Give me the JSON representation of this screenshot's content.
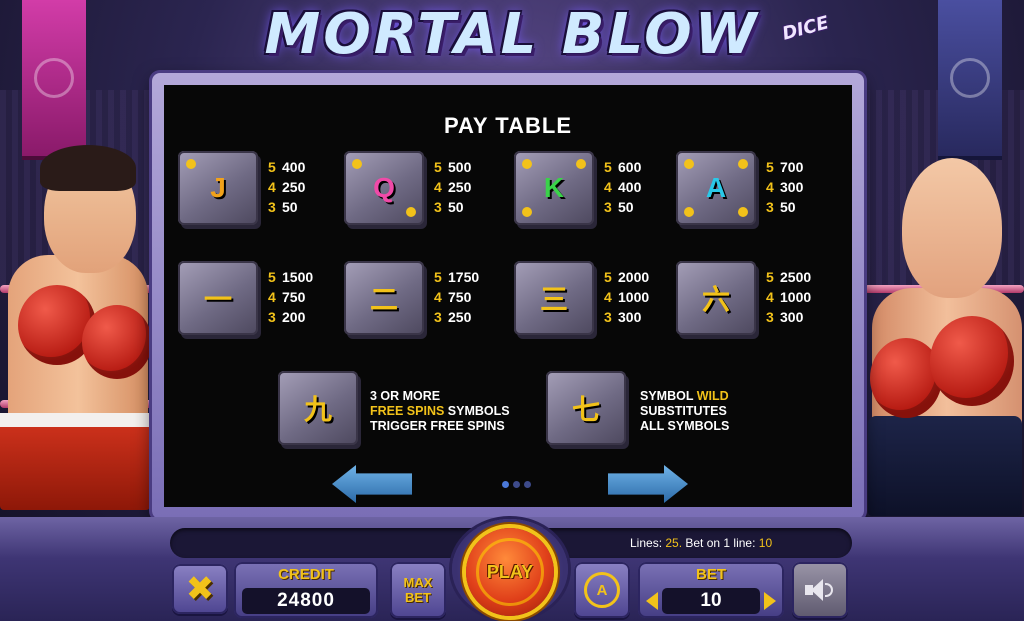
{
  "title": "MORTAL BLOW",
  "title_sub": "DICE",
  "paytable": {
    "heading": "PAY TABLE",
    "symbols": [
      {
        "icon": "J",
        "color": "#f2a21a",
        "pays": [
          {
            "count": "5",
            "value": "400"
          },
          {
            "count": "4",
            "value": "250"
          },
          {
            "count": "3",
            "value": "50"
          }
        ]
      },
      {
        "icon": "Q",
        "color": "#f04aa8",
        "pays": [
          {
            "count": "5",
            "value": "500"
          },
          {
            "count": "4",
            "value": "250"
          },
          {
            "count": "3",
            "value": "50"
          }
        ]
      },
      {
        "icon": "K",
        "color": "#3ad24a",
        "pays": [
          {
            "count": "5",
            "value": "600"
          },
          {
            "count": "4",
            "value": "400"
          },
          {
            "count": "3",
            "value": "50"
          }
        ]
      },
      {
        "icon": "A",
        "color": "#2ac8e8",
        "pays": [
          {
            "count": "5",
            "value": "700"
          },
          {
            "count": "4",
            "value": "300"
          },
          {
            "count": "3",
            "value": "50"
          }
        ]
      },
      {
        "icon": "一",
        "color": "#f2c21a",
        "pays": [
          {
            "count": "5",
            "value": "1500"
          },
          {
            "count": "4",
            "value": "750"
          },
          {
            "count": "3",
            "value": "200"
          }
        ]
      },
      {
        "icon": "二",
        "color": "#f2c21a",
        "pays": [
          {
            "count": "5",
            "value": "1750"
          },
          {
            "count": "4",
            "value": "750"
          },
          {
            "count": "3",
            "value": "250"
          }
        ]
      },
      {
        "icon": "三",
        "color": "#f2c21a",
        "pays": [
          {
            "count": "5",
            "value": "2000"
          },
          {
            "count": "4",
            "value": "1000"
          },
          {
            "count": "3",
            "value": "300"
          }
        ]
      },
      {
        "icon": "六",
        "color": "#f2c21a",
        "pays": [
          {
            "count": "5",
            "value": "2500"
          },
          {
            "count": "4",
            "value": "1000"
          },
          {
            "count": "3",
            "value": "300"
          }
        ]
      }
    ],
    "free_spins": {
      "icon": "九",
      "line1": "3 OR MORE",
      "line2_hl": "FREE SPINS",
      "line2_rest": " SYMBOLS",
      "line3": "TRIGGER FREE SPINS"
    },
    "wild": {
      "icon": "七",
      "line1_pre": "SYMBOL ",
      "line1_hl": "WILD",
      "line2": "SUBSTITUTES",
      "line3": "ALL SYMBOLS"
    }
  },
  "info": {
    "lines_label": "Lines: ",
    "lines_value": "25.",
    "bet_line_label": "  Bet on 1 line: ",
    "bet_line_value": "10"
  },
  "controls": {
    "close_symbol": "✖",
    "credit_label": "CREDIT",
    "credit_value": "24800",
    "maxbet_line1": "MAX",
    "maxbet_line2": "BET",
    "play_label": "PLAY",
    "auto_label": "A",
    "bet_label": "BET",
    "bet_value": "10"
  },
  "colors": {
    "accent_gold": "#f2c21a",
    "panel_bg": "#070707",
    "frame": "#7a6eb6"
  }
}
